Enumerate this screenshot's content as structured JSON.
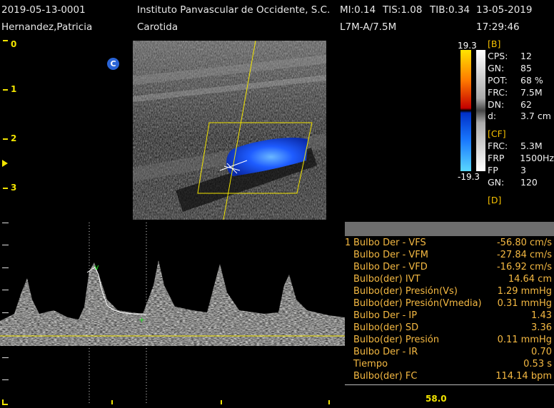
{
  "header": {
    "exam_id": "2019-05-13-0001",
    "patient_name": "Hernandez,Patricia",
    "institution": "Instituto Panvascular de Occidente, S.C.",
    "mi": "MI:0.14",
    "tis": "TIS:1.08",
    "tib": "TIB:0.34",
    "date": "13-05-2019",
    "study": "Carotida",
    "probe": "L7M-A/7.5M",
    "time": "17:29:46"
  },
  "depth_scale": [
    "0",
    "1",
    "2",
    "3"
  ],
  "orientation_marker": "C",
  "color_scale": {
    "max": "19.3",
    "min": "-19.3"
  },
  "params": {
    "b_title": "[B]",
    "b": [
      {
        "k": "CPS:",
        "v": "12"
      },
      {
        "k": "GN:",
        "v": "85"
      },
      {
        "k": "POT:",
        "v": "68 %"
      },
      {
        "k": "FRC:",
        "v": "7.5M"
      },
      {
        "k": "DN:",
        "v": "62"
      },
      {
        "k": "d:",
        "v": "3.7 cm"
      }
    ],
    "cf_title": "[CF]",
    "cf": [
      {
        "k": "FRC:",
        "v": "5.3M"
      },
      {
        "k": "FRP",
        "v": "1500Hz"
      },
      {
        "k": "FP",
        "v": "3"
      },
      {
        "k": "GN:",
        "v": "120"
      }
    ],
    "d_title": "[D]"
  },
  "measurements": [
    {
      "idx": "1",
      "label": "Bulbo Der - VFS",
      "value": "-56.80 cm/s"
    },
    {
      "idx": "",
      "label": "Bulbo Der - VFM",
      "value": "-27.84 cm/s"
    },
    {
      "idx": "",
      "label": "Bulbo Der - VFD",
      "value": "-16.92 cm/s"
    },
    {
      "idx": "",
      "label": "Bulbo(der) IVT",
      "value": "14.64 cm"
    },
    {
      "idx": "",
      "label": "Bulbo(der) Presión(Vs)",
      "value": "1.29 mmHg"
    },
    {
      "idx": "",
      "label": "Bulbo(der) Presión(Vmedia)",
      "value": "0.31 mmHg"
    },
    {
      "idx": "",
      "label": "Bulbo Der - IP",
      "value": "1.43"
    },
    {
      "idx": "",
      "label": "Bulbo(der) SD",
      "value": "3.36"
    },
    {
      "idx": "",
      "label": "Bulbo(der) Presión",
      "value": "0.11 mmHg"
    },
    {
      "idx": "",
      "label": "Bulbo Der - IR",
      "value": "0.70"
    },
    {
      "idx": "",
      "label": "Tiempo",
      "value": "0.53 s"
    },
    {
      "idx": "",
      "label": "Bulbo(der) FC",
      "value": "114.14 bpm"
    }
  ],
  "sweep_speed": "58.0",
  "colors": {
    "accent_yellow": "#f2e400",
    "measure_text": "#f5b942",
    "flow_blue": "#1e5cff",
    "caliper_green": "#22dd22"
  }
}
